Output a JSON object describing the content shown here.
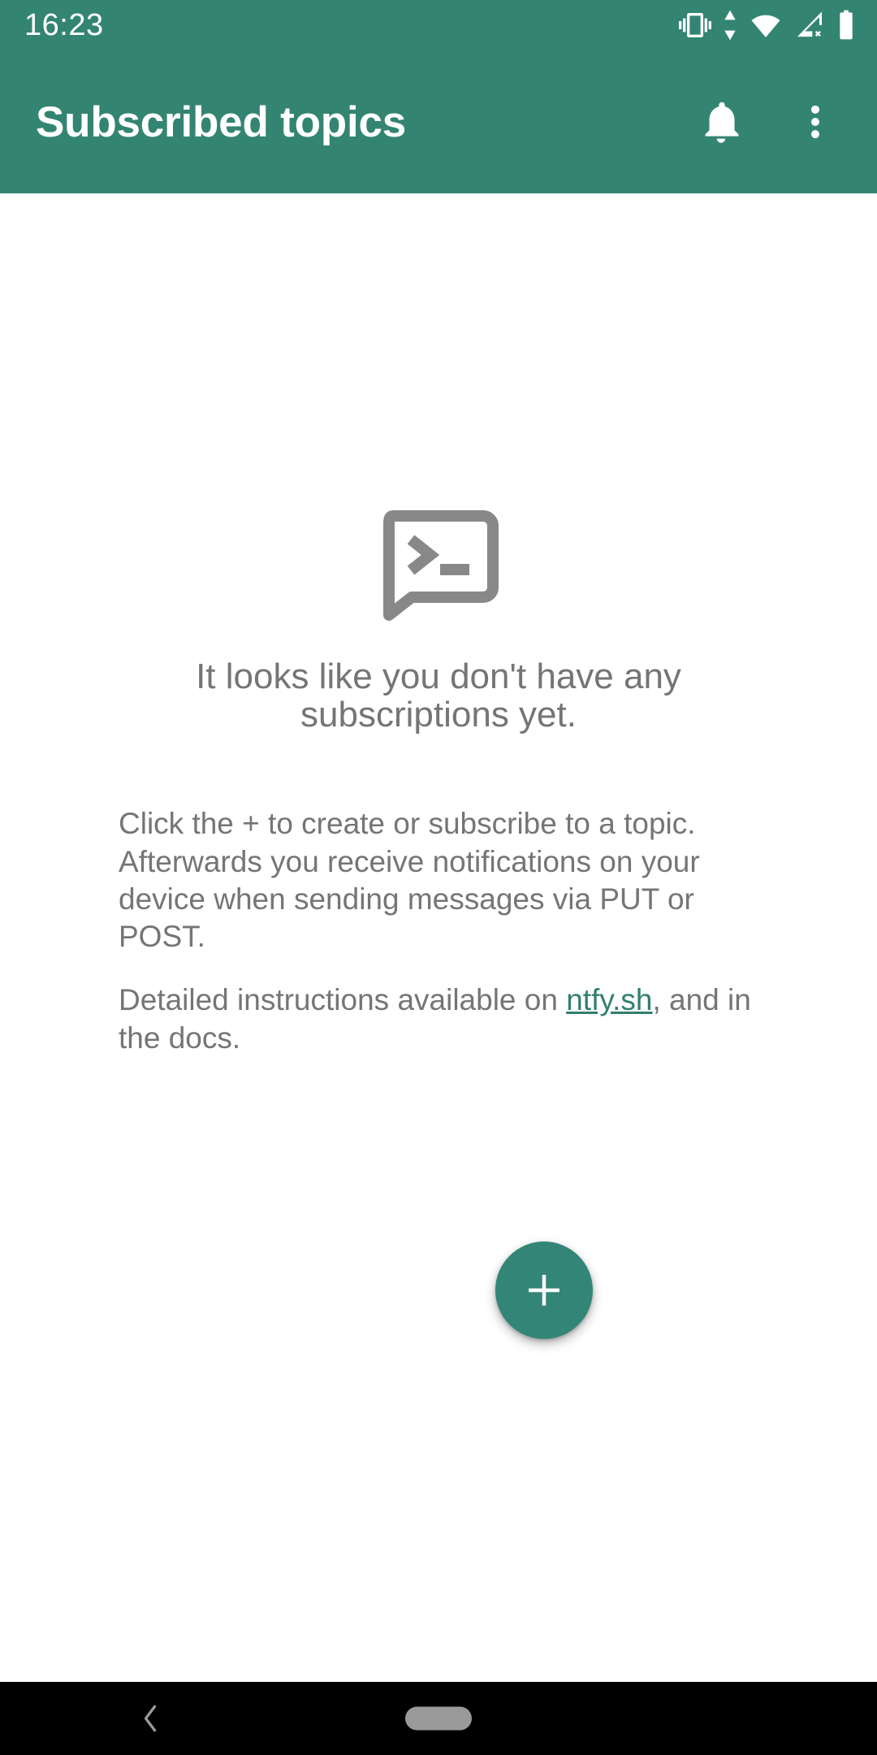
{
  "theme": {
    "primary": "#338572",
    "fab": "#338577",
    "text_gray": "#757575",
    "icon_gray": "#888888",
    "link_teal": "#317f6f",
    "navbar_bg": "#000000",
    "navbar_fg": "#9a9a9a",
    "content_bg": "#ffffff"
  },
  "status_bar": {
    "time": "16:23",
    "icons": [
      {
        "name": "vibrate-icon",
        "label": "Vibrate mode"
      },
      {
        "name": "data-transfer-icon",
        "label": "Data transfer"
      },
      {
        "name": "wifi-icon",
        "label": "Wi-Fi connected"
      },
      {
        "name": "cellular-off-icon",
        "label": "No cellular signal"
      },
      {
        "name": "battery-icon",
        "label": "Battery full"
      }
    ]
  },
  "toolbar": {
    "title": "Subscribed topics",
    "actions": [
      {
        "name": "notifications-bell-button",
        "icon": "bell-icon",
        "label": "Notifications"
      },
      {
        "name": "overflow-menu-button",
        "icon": "dots-vertical-icon",
        "label": "More options"
      }
    ]
  },
  "empty_state": {
    "icon": "terminal-chat-bubble-icon",
    "title": "It looks like you don't have any subscriptions yet.",
    "paragraph_1": "Click the + to create or subscribe to a topic. Afterwards you receive notifications on your device when sending messages via PUT or POST.",
    "paragraph_2_before": "Detailed instructions available on ",
    "paragraph_2_link": "ntfy.sh",
    "paragraph_2_after": ", and in the docs."
  },
  "fab": {
    "name": "add-subscription-fab",
    "icon": "plus-icon",
    "label": "+"
  },
  "nav_bar": {
    "back": {
      "name": "nav-back-button",
      "icon": "chevron-left-icon"
    },
    "home": {
      "name": "nav-home-pill",
      "icon": "home-pill-icon"
    }
  }
}
